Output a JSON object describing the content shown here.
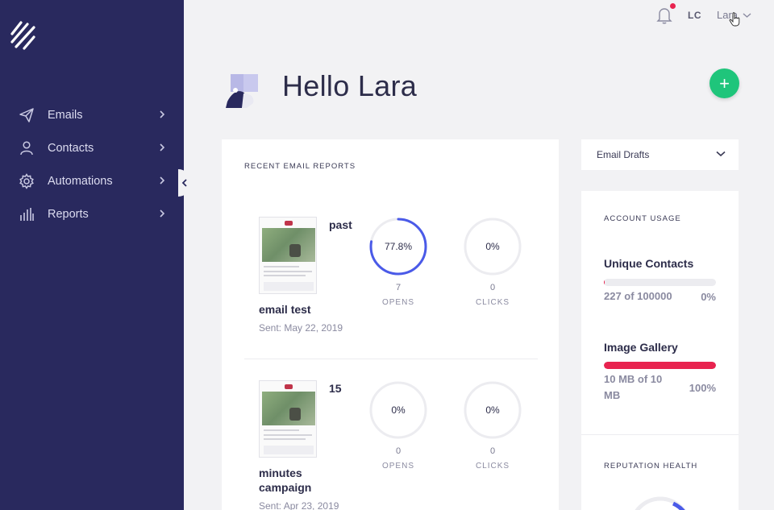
{
  "sidebar": {
    "items": [
      {
        "label": "Emails",
        "icon": "paper-plane-icon"
      },
      {
        "label": "Contacts",
        "icon": "person-icon"
      },
      {
        "label": "Automations",
        "icon": "gear-icon"
      },
      {
        "label": "Reports",
        "icon": "bar-chart-icon"
      }
    ]
  },
  "topbar": {
    "avatar_initials": "LC",
    "user_name": "Lara"
  },
  "header": {
    "greeting": "Hello Lara",
    "add_button": "+"
  },
  "reports": {
    "title": "RECENT EMAIL REPORTS",
    "items": [
      {
        "title_right": "past",
        "title": "email test",
        "sent": "Sent: May 22, 2019",
        "opens_pct_label": "77.8%",
        "opens_fraction": 0.778,
        "opens_count": "7",
        "opens_caption": "OPENS",
        "clicks_pct_label": "0%",
        "clicks_fraction": 0,
        "clicks_count": "0",
        "clicks_caption": "CLICKS"
      },
      {
        "title_right": "15",
        "title": "minutes campaign",
        "sent": "Sent: Apr 23, 2019",
        "opens_pct_label": "0%",
        "opens_fraction": 0,
        "opens_count": "0",
        "opens_caption": "OPENS",
        "clicks_pct_label": "0%",
        "clicks_fraction": 0,
        "clicks_count": "0",
        "clicks_caption": "CLICKS"
      }
    ]
  },
  "drafts": {
    "selected": "Email Drafts"
  },
  "usage": {
    "title": "ACCOUNT USAGE",
    "contacts_name": "Unique Contacts",
    "contacts_value": "227 of 100000",
    "contacts_pct": "0%",
    "contacts_fraction": 0.0023,
    "gallery_name": "Image Gallery",
    "gallery_value": "10 MB of 10 MB",
    "gallery_pct": "100%",
    "gallery_fraction": 1.0,
    "reputation_title": "REPUTATION HEALTH"
  },
  "colors": {
    "sidebar": "#29295e",
    "accent_green": "#1fc57b",
    "alert_red": "#e8234f",
    "ring_blue": "#4a5ae8"
  }
}
